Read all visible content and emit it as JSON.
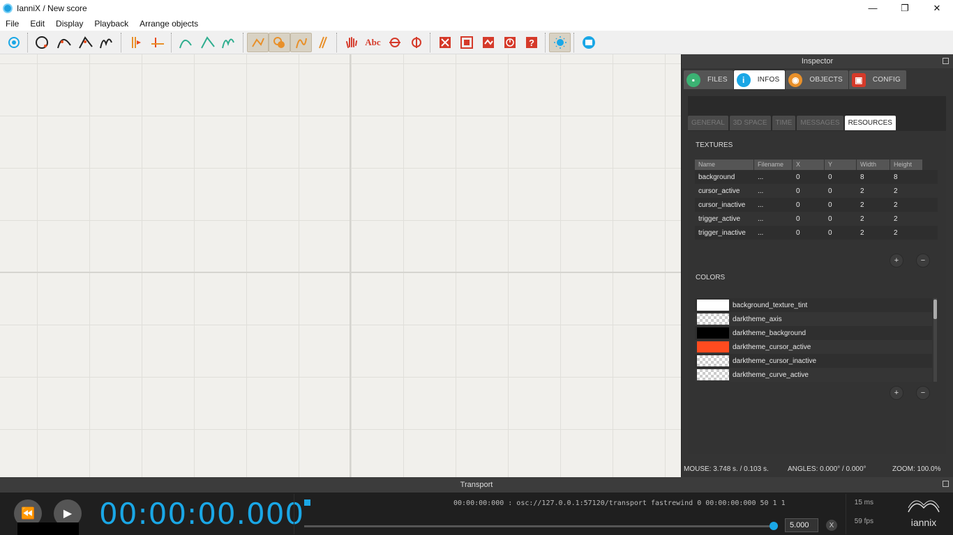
{
  "window": {
    "title": "IanniX / New score",
    "min": "—",
    "max": "❐",
    "close": "✕"
  },
  "menu": [
    "File",
    "Edit",
    "Display",
    "Playback",
    "Arrange objects"
  ],
  "inspector": {
    "title": "Inspector",
    "tabs": [
      {
        "label": "FILES",
        "icon": "folder-icon",
        "color": "#3bb273",
        "glyph": "▪"
      },
      {
        "label": "INFOS",
        "icon": "info-icon",
        "color": "#1aa7e6",
        "glyph": "i"
      },
      {
        "label": "OBJECTS",
        "icon": "eye-icon",
        "color": "#e8902a",
        "glyph": "◉"
      },
      {
        "label": "CONFIG",
        "icon": "network-icon",
        "color": "#d53a2a",
        "glyph": "▣"
      }
    ],
    "subtabs": [
      "GENERAL",
      "3D SPACE",
      "TIME",
      "MESSAGES",
      "RESOURCES"
    ],
    "textures_title": "TEXTURES",
    "textures_headers": [
      "Name",
      "Filename",
      "X",
      "Y",
      "Width",
      "Height"
    ],
    "textures": [
      [
        "background",
        "...",
        "0",
        "0",
        "8",
        "8"
      ],
      [
        "cursor_active",
        "...",
        "0",
        "0",
        "2",
        "2"
      ],
      [
        "cursor_inactive",
        "...",
        "0",
        "0",
        "2",
        "2"
      ],
      [
        "trigger_active",
        "...",
        "0",
        "0",
        "2",
        "2"
      ],
      [
        "trigger_inactive",
        "...",
        "0",
        "0",
        "2",
        "2"
      ]
    ],
    "colors_title": "COLORS",
    "colors": [
      {
        "name": "background_texture_tint",
        "color": "#ffffff"
      },
      {
        "name": "darktheme_axis",
        "color": "checker"
      },
      {
        "name": "darktheme_background",
        "color": "#000000"
      },
      {
        "name": "darktheme_cursor_active",
        "color": "#ff4b1f"
      },
      {
        "name": "darktheme_cursor_inactive",
        "color": "checker"
      },
      {
        "name": "darktheme_curve_active",
        "color": "checker"
      }
    ],
    "add": "+",
    "remove": "−",
    "status": {
      "mouse": "MOUSE: 3.748 s. / 0.103 s.",
      "angles": "ANGLES: 0.000° / 0.000°",
      "zoom": "ZOOM: 100.0%"
    }
  },
  "transport": {
    "title": "Transport",
    "time": "00:00:00.000",
    "osc": "00:00:00:000 : osc://127.0.0.1:57120/transport fastrewind 0 00:00:00:000 50 1 1",
    "speed": "5.000",
    "x": "X",
    "latency": "15 ms",
    "fps": "59 fps",
    "logo": "iannix"
  }
}
